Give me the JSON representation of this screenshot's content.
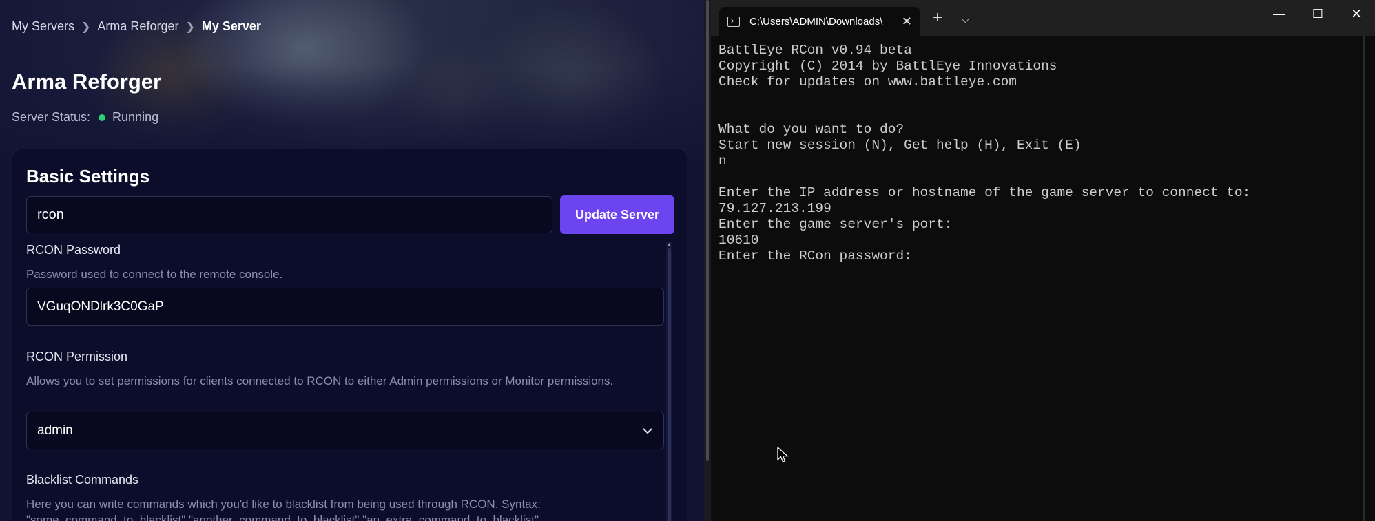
{
  "breadcrumb": {
    "items": [
      "My Servers",
      "Arma Reforger",
      "My Server"
    ]
  },
  "app": {
    "title": "Arma Reforger",
    "status_label": "Server Status:",
    "status_value": "Running",
    "status_color": "#2fcf78"
  },
  "basic_settings": {
    "title": "Basic Settings",
    "search_value": "rcon",
    "update_button": "Update Server",
    "accent_color": "#6d45f0",
    "rcon_password": {
      "label": "RCON Password",
      "description": "Password used to connect to the remote console.",
      "value": "VGuqONDlrk3C0GaP"
    },
    "rcon_permission": {
      "label": "RCON Permission",
      "description": "Allows you to set permissions for clients connected to RCON to either Admin permissions or Monitor permissions.",
      "value": "admin"
    },
    "blacklist_commands": {
      "label": "Blacklist Commands",
      "description": "Here you can write commands which you'd like to blacklist from being used through RCON. Syntax: \"some_command_to_blacklist\",\"another_command_to_blacklist\",\"an_extra_command_to_blacklist\""
    }
  },
  "terminal": {
    "tab_title": "C:\\Users\\ADMIN\\Downloads\\",
    "lines": [
      "BattlEye RCon v0.94 beta",
      "Copyright (C) 2014 by BattlEye Innovations",
      "Check for updates on www.battleye.com",
      "",
      "",
      "What do you want to do?",
      "Start new session (N), Get help (H), Exit (E)",
      "n",
      "",
      "Enter the IP address or hostname of the game server to connect to:",
      "79.127.213.199",
      "Enter the game server's port:",
      "10610",
      "Enter the RCon password:"
    ]
  }
}
